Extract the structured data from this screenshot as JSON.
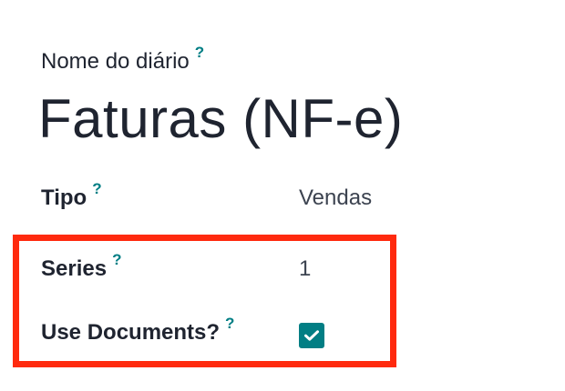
{
  "form": {
    "journal_name_label": "Nome do diário",
    "journal_title": "Faturas (NF-e)",
    "help_glyph": "?",
    "fields": {
      "tipo": {
        "label": "Tipo",
        "value": "Vendas"
      },
      "series": {
        "label": "Series",
        "value": "1"
      },
      "use_documents": {
        "label": "Use Documents?",
        "checked": true
      }
    }
  },
  "icons": {
    "help": "question-mark-icon",
    "checkbox_check": "checkmark-icon"
  },
  "colors": {
    "accent": "#017e84",
    "highlight": "#ff2a0e",
    "text": "#1f2430"
  }
}
